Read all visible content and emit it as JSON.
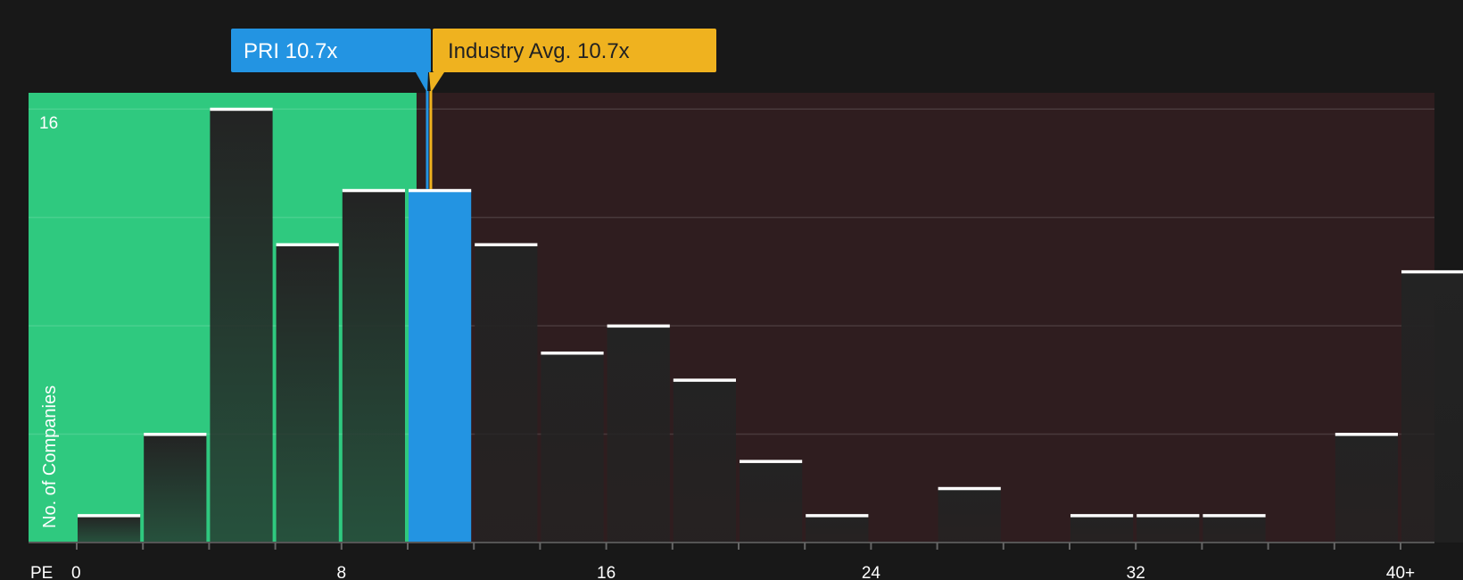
{
  "chart_data": {
    "type": "bar",
    "x_axis_label": "PE",
    "ylabel": "No. of Companies",
    "x_ticks": [
      "0",
      "8",
      "16",
      "24",
      "32",
      "40+"
    ],
    "y_ticks": [
      "16"
    ],
    "ylim": [
      0,
      16.6
    ],
    "bin_width": 2,
    "bins": [
      {
        "start": 0,
        "value": 1
      },
      {
        "start": 2,
        "value": 4
      },
      {
        "start": 4,
        "value": 16
      },
      {
        "start": 6,
        "value": 11
      },
      {
        "start": 8,
        "value": 13
      },
      {
        "start": 10,
        "value": 13,
        "highlight": true
      },
      {
        "start": 12,
        "value": 11
      },
      {
        "start": 14,
        "value": 7
      },
      {
        "start": 16,
        "value": 8
      },
      {
        "start": 18,
        "value": 6
      },
      {
        "start": 20,
        "value": 3
      },
      {
        "start": 22,
        "value": 1
      },
      {
        "start": 24,
        "value": 0
      },
      {
        "start": 26,
        "value": 2
      },
      {
        "start": 28,
        "value": 0
      },
      {
        "start": 30,
        "value": 1
      },
      {
        "start": 32,
        "value": 1
      },
      {
        "start": 34,
        "value": 1
      },
      {
        "start": 36,
        "value": 0
      },
      {
        "start": 38,
        "value": 4
      },
      {
        "start": 40,
        "value": 10
      }
    ],
    "company": {
      "label": "PRI 10.7x",
      "value": 10.7,
      "color": "#2394e2"
    },
    "industry": {
      "label": "Industry Avg. 10.7x",
      "value": 10.7,
      "color": "#efb21f"
    },
    "colors": {
      "background": "#181818",
      "undervalued_zone": "#2fc97f",
      "overvalued_zone": "#2f1d1f",
      "bar": "#232323",
      "highlight_bar": "#2394e2",
      "bar_top": "#ffffff"
    }
  }
}
